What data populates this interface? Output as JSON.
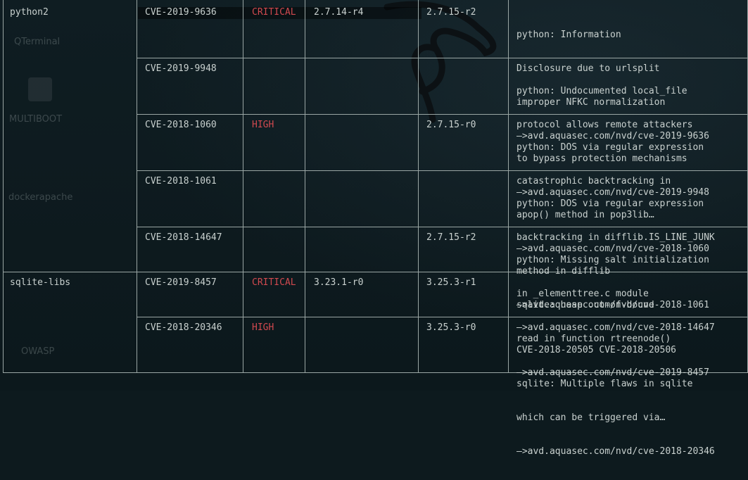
{
  "desktop": {
    "icons": [
      {
        "label": "QTerminal",
        "icon": "terminal-icon"
      },
      {
        "label": "MULTIBOOT",
        "icon": "usb-icon"
      },
      {
        "label": "dockerapache",
        "icon": "folder-icon"
      },
      {
        "label": "OWASP",
        "icon": "folder-icon"
      }
    ]
  },
  "table": {
    "rows": [
      {
        "library": "python2",
        "vuln_id": "CVE-2019-9636",
        "severity": "CRITICAL",
        "installed": "2.7.14-r4",
        "fixed": "2.7.15-r2",
        "title": [
          "python: Information",
          "Disclosure due to urlsplit",
          "improper NFKC normalization",
          "—>avd.aquasec.com/nvd/cve-2019-9636"
        ]
      },
      {
        "library": "",
        "vuln_id": "CVE-2019-9948",
        "severity": "",
        "installed": "",
        "fixed": "",
        "title": [
          "python: Undocumented local_file",
          "protocol allows remote attackers",
          "to bypass protection mechanisms",
          "—>avd.aquasec.com/nvd/cve-2019-9948"
        ]
      },
      {
        "library": "",
        "vuln_id": "CVE-2018-1060",
        "severity": "HIGH",
        "installed": "",
        "fixed": "2.7.15-r0",
        "title": [
          "python: DOS via regular expression",
          "catastrophic backtracking in",
          "apop() method in pop3lib…",
          "—>avd.aquasec.com/nvd/cve-2018-1060"
        ]
      },
      {
        "library": "",
        "vuln_id": "CVE-2018-1061",
        "severity": "",
        "installed": "",
        "fixed": "",
        "title": [
          "python: DOS via regular expression",
          "backtracking in difflib.IS_LINE_JUNK",
          "method in difflib",
          "—>avd.aquasec.com/nvd/cve-2018-1061"
        ]
      },
      {
        "library": "",
        "vuln_id": "CVE-2018-14647",
        "severity": "",
        "installed": "",
        "fixed": "2.7.15-r2",
        "title": [
          "python: Missing salt initialization",
          "in _elementtree.c module",
          "—>avd.aquasec.com/nvd/cve-2018-14647"
        ]
      },
      {
        "library": "sqlite-libs",
        "vuln_id": "CVE-2019-8457",
        "severity": "CRITICAL",
        "installed": "3.23.1-r0",
        "fixed": "3.25.3-r1",
        "title": [
          "sqlite: heap out-of-bound",
          "read in function rtreenode()",
          "—>avd.aquasec.com/nvd/cve-2019-8457"
        ]
      },
      {
        "library": "",
        "vuln_id": "CVE-2018-20346",
        "severity": "HIGH",
        "installed": "",
        "fixed": "3.25.3-r0",
        "title": [
          "CVE-2018-20505 CVE-2018-20506",
          "sqlite: Multiple flaws in sqlite",
          "which can be triggered via…",
          "—>avd.aquasec.com/nvd/cve-2018-20346"
        ]
      }
    ]
  },
  "colors": {
    "severity_red": "#d0494f",
    "border": "#9aa6a4",
    "text": "#c9d1cf",
    "background": "#0d1a1e"
  }
}
